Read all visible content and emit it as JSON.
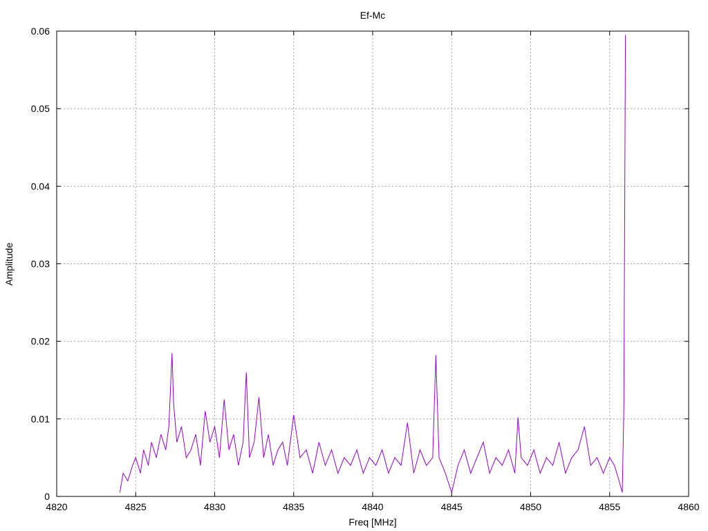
{
  "chart_data": {
    "type": "line",
    "title": "Ef-Mc",
    "xlabel": "Freq [MHz]",
    "ylabel": "Amplitude",
    "xlim": [
      4820,
      4860
    ],
    "ylim": [
      0,
      0.06
    ],
    "xticks": [
      4820,
      4825,
      4830,
      4835,
      4840,
      4845,
      4850,
      4855,
      4860
    ],
    "xtick_labels": [
      "4820",
      "4825",
      "4830",
      "4835",
      "4840",
      "4845",
      "4850",
      "4855",
      "4860"
    ],
    "yticks": [
      0,
      0.01,
      0.02,
      0.03,
      0.04,
      0.05,
      0.06
    ],
    "ytick_labels": [
      "0",
      "0.01",
      "0.02",
      "0.03",
      "0.04",
      "0.05",
      "0.06"
    ],
    "grid": true,
    "legend": "none",
    "series": [
      {
        "color": "#9400d3",
        "x": [
          4824.0,
          4824.2,
          4824.5,
          4824.8,
          4825.0,
          4825.3,
          4825.5,
          4825.8,
          4826.0,
          4826.3,
          4826.6,
          4826.9,
          4827.1,
          4827.3,
          4827.4,
          4827.6,
          4827.9,
          4828.2,
          4828.5,
          4828.8,
          4829.1,
          4829.4,
          4829.7,
          4830.0,
          4830.3,
          4830.6,
          4830.9,
          4831.2,
          4831.5,
          4831.8,
          4832.0,
          4832.2,
          4832.5,
          4832.8,
          4833.1,
          4833.4,
          4833.7,
          4834.0,
          4834.3,
          4834.6,
          4835.0,
          4835.4,
          4835.8,
          4836.2,
          4836.6,
          4837.0,
          4837.4,
          4837.8,
          4838.2,
          4838.6,
          4839.0,
          4839.4,
          4839.8,
          4840.2,
          4840.6,
          4841.0,
          4841.4,
          4841.8,
          4842.2,
          4842.6,
          4843.0,
          4843.4,
          4843.8,
          4844.0,
          4844.2,
          4844.6,
          4845.0,
          4845.4,
          4845.8,
          4846.2,
          4846.6,
          4847.0,
          4847.4,
          4847.8,
          4848.2,
          4848.6,
          4849.0,
          4849.2,
          4849.4,
          4849.8,
          4850.2,
          4850.6,
          4851.0,
          4851.4,
          4851.8,
          4852.2,
          4852.6,
          4853.0,
          4853.4,
          4853.8,
          4854.2,
          4854.6,
          4855.0,
          4855.3,
          4855.6,
          4855.8,
          4855.9,
          4856.0
        ],
        "y": [
          0.0005,
          0.003,
          0.002,
          0.004,
          0.005,
          0.003,
          0.006,
          0.004,
          0.007,
          0.005,
          0.008,
          0.006,
          0.009,
          0.0185,
          0.012,
          0.007,
          0.009,
          0.005,
          0.006,
          0.008,
          0.004,
          0.011,
          0.007,
          0.009,
          0.005,
          0.0125,
          0.006,
          0.008,
          0.004,
          0.007,
          0.016,
          0.005,
          0.007,
          0.0128,
          0.005,
          0.008,
          0.004,
          0.006,
          0.007,
          0.004,
          0.0105,
          0.005,
          0.006,
          0.003,
          0.007,
          0.004,
          0.006,
          0.003,
          0.005,
          0.004,
          0.006,
          0.003,
          0.005,
          0.004,
          0.006,
          0.003,
          0.005,
          0.004,
          0.0095,
          0.003,
          0.006,
          0.004,
          0.005,
          0.0182,
          0.005,
          0.003,
          0.0005,
          0.004,
          0.006,
          0.003,
          0.005,
          0.007,
          0.003,
          0.005,
          0.004,
          0.006,
          0.003,
          0.0102,
          0.005,
          0.004,
          0.006,
          0.003,
          0.005,
          0.004,
          0.007,
          0.003,
          0.005,
          0.006,
          0.009,
          0.004,
          0.005,
          0.003,
          0.005,
          0.004,
          0.002,
          0.0005,
          0.0115,
          0.0595
        ]
      }
    ]
  }
}
